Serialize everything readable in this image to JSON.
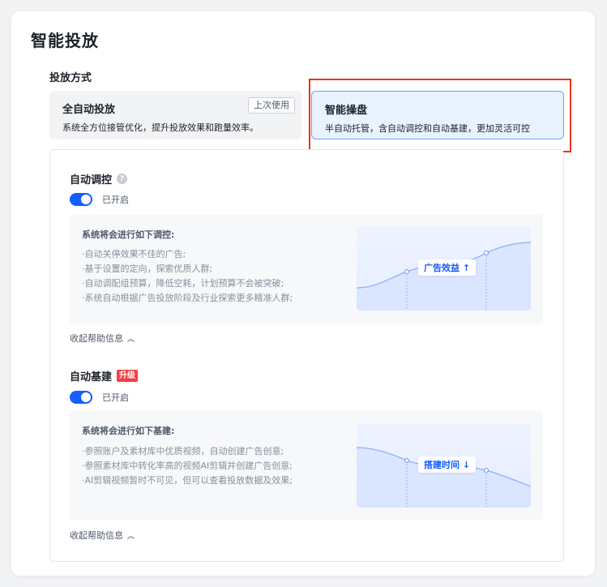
{
  "page": {
    "title": "智能投放"
  },
  "delivery": {
    "label": "投放方式",
    "modes": [
      {
        "title": "全自动投放",
        "description": "系统全方位接管优化，提升投放效果和跑量效率。",
        "badge": "上次使用",
        "selected": false
      },
      {
        "title": "智能操盘",
        "description": "半自动托管，含自动调控和自动基建，更加灵活可控",
        "selected": true
      }
    ]
  },
  "auto_control": {
    "title": "自动调控",
    "help_icon": "question-circle-icon",
    "toggle": {
      "on": true,
      "label": "已开启"
    },
    "info_heading": "系统将会进行如下调控:",
    "items": [
      "·自动关停效果不佳的广告;",
      "·基于设置的定向，探索优质人群;",
      "·自动调配组预算，降低空耗，计划预算不会被突破;",
      "·系统自动根据广告投放阶段及行业探索更多精准人群;"
    ],
    "chart_tag": "广告效益 ↑",
    "collapse": "收起帮助信息"
  },
  "auto_build": {
    "title": "自动基建",
    "badge": "升级",
    "toggle": {
      "on": true,
      "label": "已开启"
    },
    "info_heading": "系统将会进行如下基建:",
    "items": [
      "·参照账户及素材库中优质视频，自动创建广告创意;",
      "·参照素材库中转化率高的视频AI剪辑并创建广告创意;",
      "·AI剪辑视频暂时不可见，但可以查看投放数据及效果;"
    ],
    "chart_tag": "搭建时间 ↓",
    "collapse": "收起帮助信息"
  },
  "colors": {
    "primary": "#165dff",
    "highlight": "#e8331d",
    "badge": "#f53f3f"
  }
}
